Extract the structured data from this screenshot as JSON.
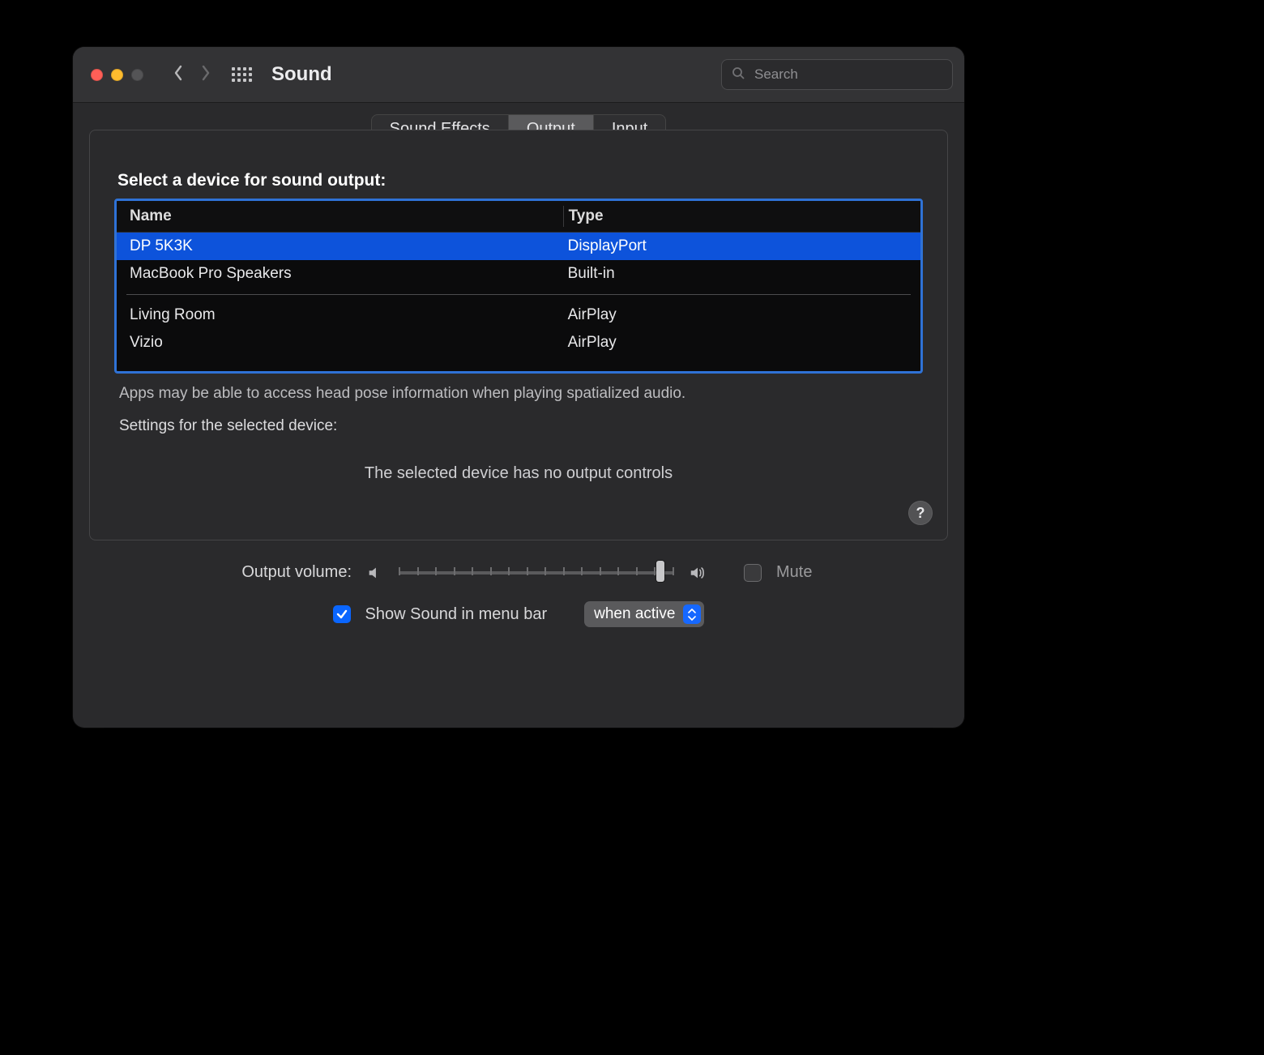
{
  "window": {
    "title": "Sound"
  },
  "search": {
    "placeholder": "Search",
    "value": ""
  },
  "tabs": {
    "items": [
      "Sound Effects",
      "Output",
      "Input"
    ],
    "active_index": 1
  },
  "output": {
    "heading": "Select a device for sound output:",
    "columns": {
      "name": "Name",
      "type": "Type"
    },
    "devices": [
      {
        "name": "DP 5K3K",
        "type": "DisplayPort",
        "selected": true
      },
      {
        "name": "MacBook Pro Speakers",
        "type": "Built-in",
        "selected": false
      },
      {
        "name": "Living Room",
        "type": "AirPlay",
        "selected": false
      },
      {
        "name": "Vizio",
        "type": "AirPlay",
        "selected": false
      }
    ],
    "spatial_hint": "Apps may be able to access head pose information when playing spatialized audio.",
    "settings_label": "Settings for the selected device:",
    "no_controls_text": "The selected device has no output controls"
  },
  "volume": {
    "label": "Output volume:",
    "value_percent": 95,
    "mute_label": "Mute",
    "mute_checked": false
  },
  "menubar": {
    "checkbox_label": "Show Sound in menu bar",
    "checked": true,
    "popup_value": "when active"
  },
  "colors": {
    "selection_blue": "#0d53db",
    "focus_ring": "#2f72d6",
    "accent": "#0a66ff"
  }
}
